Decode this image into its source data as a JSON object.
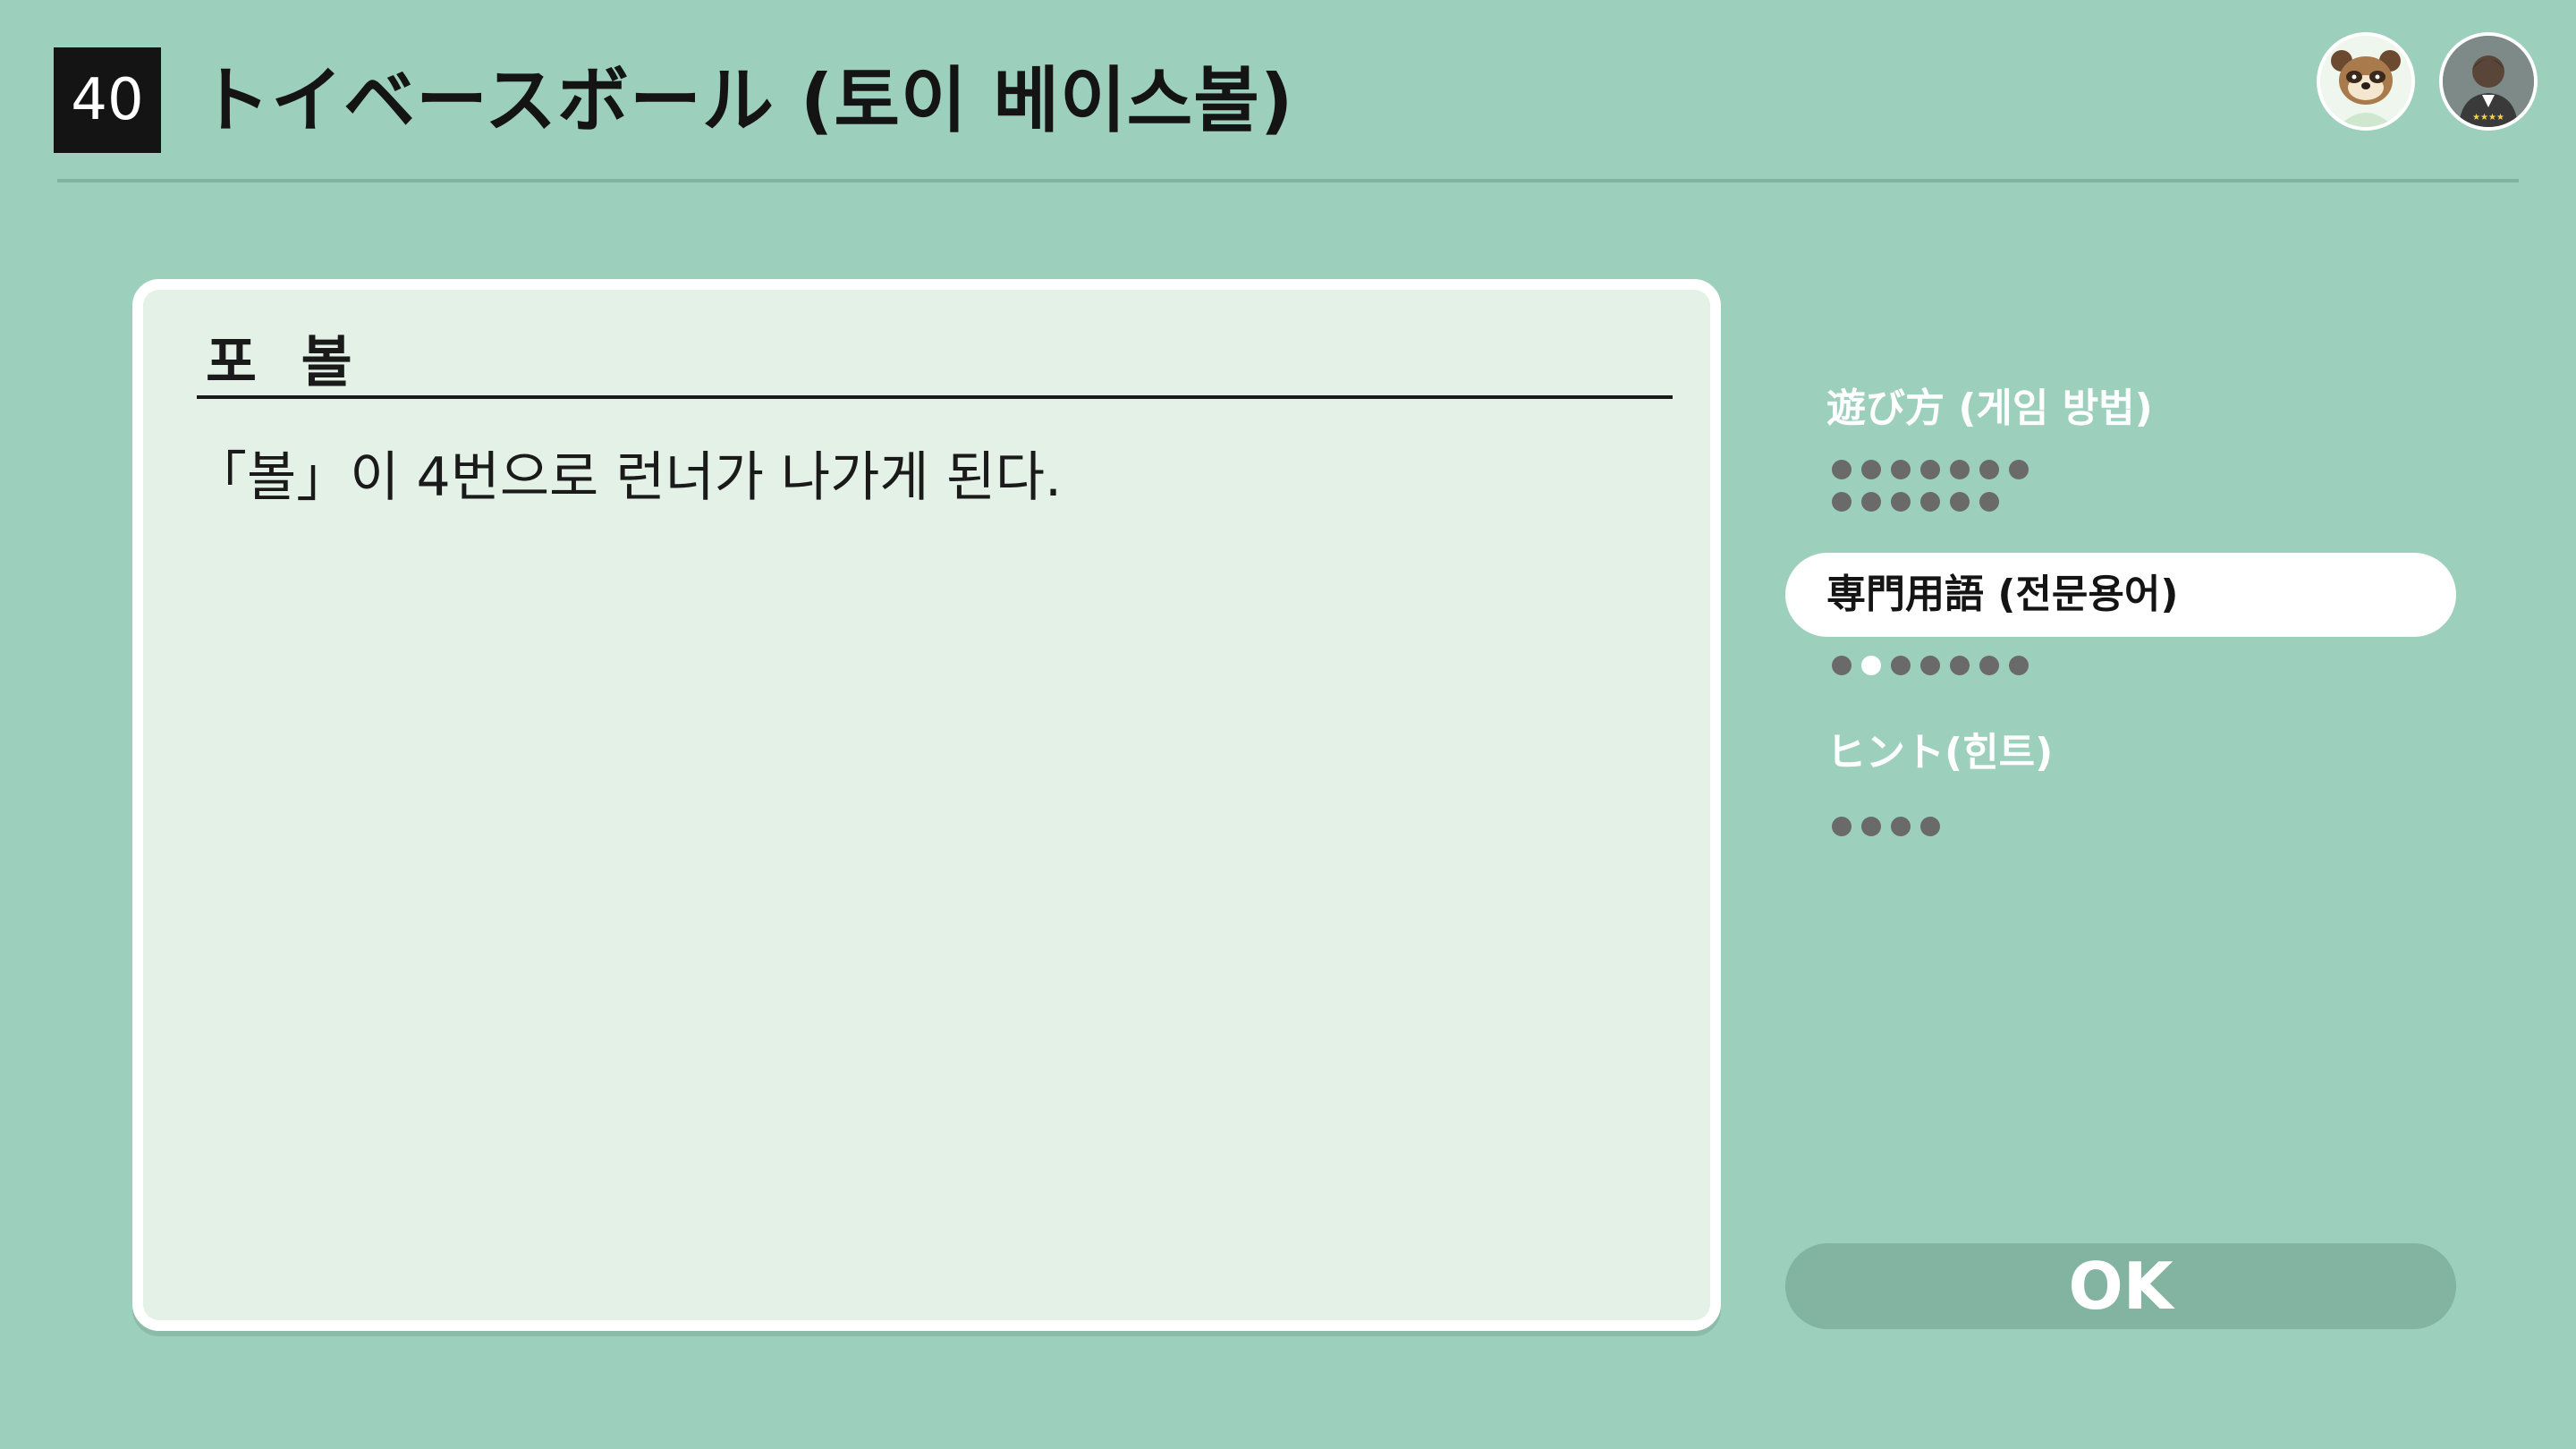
{
  "header": {
    "game_number": "40",
    "title": "トイベースボール (토이 베이스볼)"
  },
  "avatars": [
    {
      "icon": "raccoon-character-icon"
    },
    {
      "icon": "user-profile-icon"
    }
  ],
  "card": {
    "title": "포 볼",
    "body": "「볼」이 4번으로 런너가 나가게 된다."
  },
  "menu": {
    "items": [
      {
        "label": "遊び方 (게임 방법)",
        "page_count": 13,
        "active_page": null,
        "selected": false
      },
      {
        "label": "専門用語 (전문용어)",
        "page_count": 7,
        "active_page": 2,
        "selected": true
      },
      {
        "label": "ヒント(힌트)",
        "page_count": 4,
        "active_page": null,
        "selected": false
      }
    ]
  },
  "ok_button": {
    "label": "OK"
  },
  "colors": {
    "background": "#9dcfbd",
    "card": "#e3f1e7",
    "selected_item": "#ffffff",
    "ok_button": "#83b3a1"
  }
}
